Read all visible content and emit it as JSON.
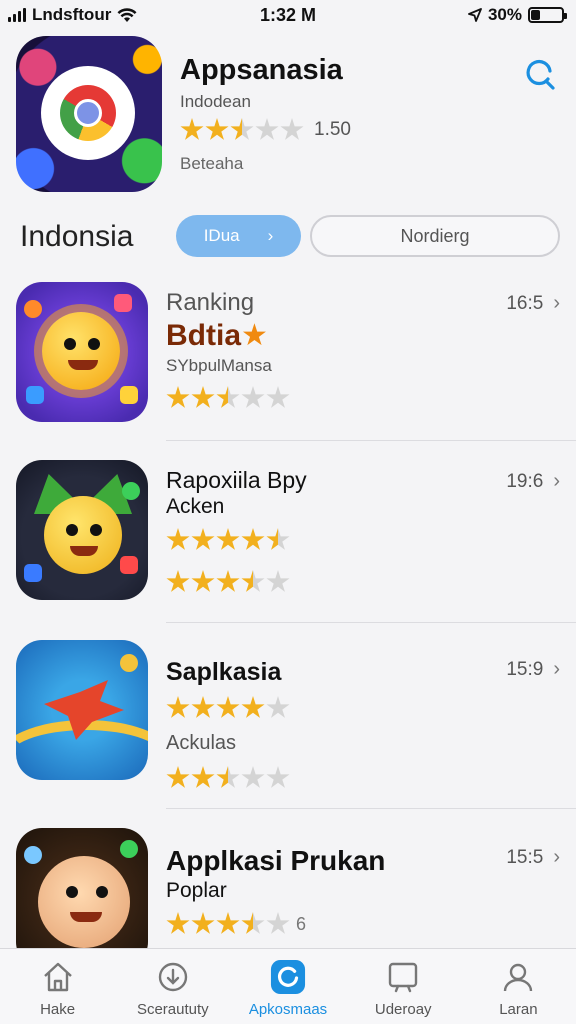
{
  "status_bar": {
    "carrier": "Lndsftour",
    "time": "1:32 M",
    "battery_percent": "30%",
    "battery_level": 0.3
  },
  "header": {
    "title": "Appsanasia",
    "subtitle": "Indodean",
    "rating_value": "1.50",
    "rating_stars": 2.5,
    "developer": "Beteaha",
    "search_icon": "search-icon"
  },
  "filter": {
    "region_title": "Indonsia",
    "active_pill": "IDua",
    "inactive_pill": "Nordierg"
  },
  "apps": [
    {
      "label": "Ranking",
      "title": "Bdtia",
      "subtitle": "SYbpulMansa",
      "stars": 2.5,
      "time": "16:5"
    },
    {
      "title": "Rapoxiila Bpy",
      "subtitle": "Acken",
      "stars_1": 4.5,
      "stars_2": 3.5,
      "time": "19:6"
    },
    {
      "title": "Saplkasia",
      "stars_1": 4,
      "subtitle": "Ackulas",
      "stars_2": 2.5,
      "time": "15:9"
    },
    {
      "title": "Applkasi Prukan",
      "subtitle": "Poplar",
      "stars": 3.5,
      "stars_suffix": "6",
      "time": "15:5"
    }
  ],
  "tabs": [
    {
      "label": "Hake",
      "icon": "home-icon"
    },
    {
      "label": "Sceraututy",
      "icon": "compass-icon"
    },
    {
      "label": "Apkosmaas",
      "icon": "apps-icon",
      "active": true
    },
    {
      "label": "Uderoay",
      "icon": "updates-icon"
    },
    {
      "label": "Laran",
      "icon": "profile-icon"
    }
  ],
  "colors": {
    "accent": "#1b8fe0",
    "star": "#f2b01e",
    "pill_active": "#7eb8ee",
    "title_brown": "#7a2a06"
  }
}
